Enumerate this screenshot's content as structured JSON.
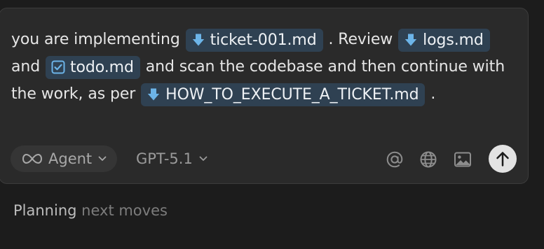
{
  "composer": {
    "message": {
      "part1": "you are implementing",
      "chip1": "ticket-001.md",
      "part2": ". Review",
      "chip2": "logs.md",
      "part3": "and",
      "chip3": "todo.md",
      "part4": "and scan the codebase and then continue with the work, as per",
      "chip4": "HOW_TO_EXECUTE_A_TICKET.md",
      "part5": "."
    },
    "toolbar": {
      "mode_label": "Agent",
      "model_label": "GPT-5.1"
    }
  },
  "status": {
    "primary": "Planning",
    "secondary": "next moves"
  },
  "colors": {
    "background": "#1c1c1c",
    "composer_bg": "#2a2a2a",
    "chip_bg": "#2f4152",
    "icon_accent": "#6cb4e8"
  },
  "icons": [
    "download-file-icon",
    "checkbox-file-icon",
    "infinity-icon",
    "chevron-down-icon",
    "at-icon",
    "globe-icon",
    "image-icon",
    "arrow-up-icon"
  ]
}
